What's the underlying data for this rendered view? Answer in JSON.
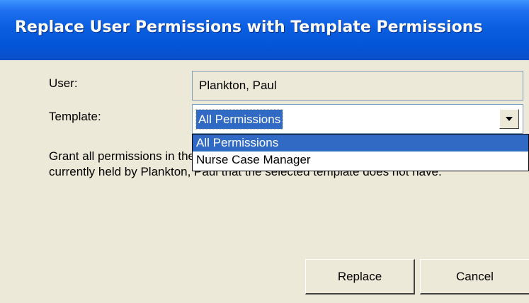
{
  "dialog": {
    "title": "Replace User Permissions with Template Permissions"
  },
  "user": {
    "label": "User:",
    "value": "Plankton, Paul"
  },
  "template": {
    "label": "Template:",
    "selected": "All Permissions",
    "options": [
      "All Permissions",
      "Nurse Case Manager"
    ]
  },
  "description": "Grant all permissions in the selected template to Plankton, Paul. Revoke any privileges currently held by Plankton, Paul that the selected template does not have.",
  "buttons": {
    "replace": "Replace",
    "cancel": "Cancel"
  },
  "colors": {
    "titlebar": "#0a5fe0",
    "selection": "#316ac5",
    "dialog_bg": "#ece9d8"
  }
}
